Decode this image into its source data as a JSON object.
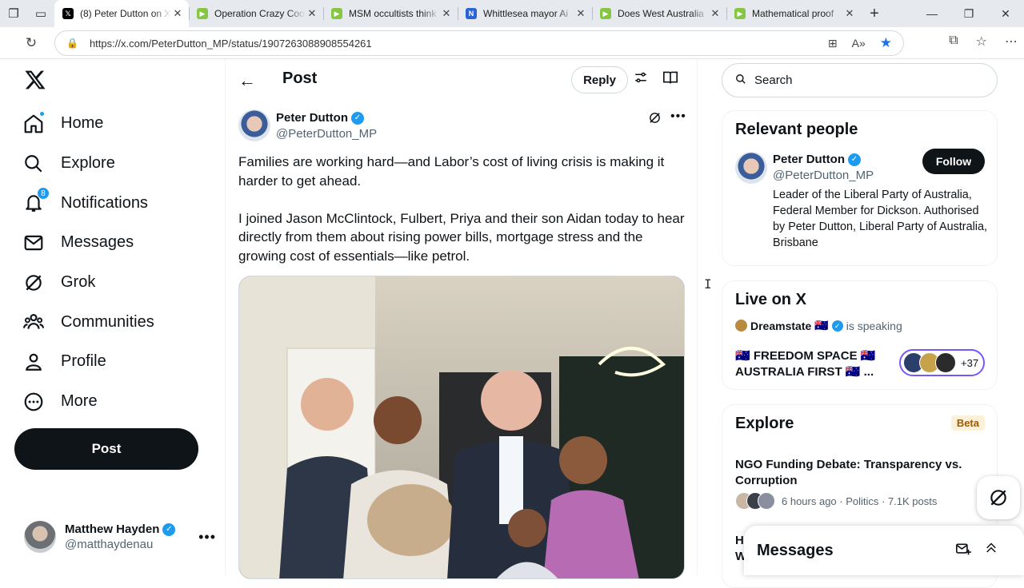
{
  "browser": {
    "tabs": [
      {
        "title": "(8) Peter Dutton on X",
        "active": true,
        "favicon": "x-logo",
        "color": "#000000"
      },
      {
        "title": "Operation Crazy Cooking",
        "active": false,
        "favicon": "rumble-icon",
        "color": "#85c742"
      },
      {
        "title": "MSM occultists think",
        "active": false,
        "favicon": "rumble-icon",
        "color": "#85c742"
      },
      {
        "title": "Whittlesea mayor Ai",
        "active": false,
        "favicon": "news-icon",
        "color": "#2a63d6"
      },
      {
        "title": "Does West Australia",
        "active": false,
        "favicon": "rumble-icon",
        "color": "#85c742"
      },
      {
        "title": "Mathematical proof",
        "active": false,
        "favicon": "rumble-icon",
        "color": "#85c742"
      }
    ],
    "url": "https://x.com/PeterDutton_MP/status/1907263088908554261"
  },
  "nav": {
    "items": [
      {
        "label": "Home",
        "icon": "home-icon"
      },
      {
        "label": "Explore",
        "icon": "search-icon"
      },
      {
        "label": "Notifications",
        "icon": "bell-icon",
        "badge": "8"
      },
      {
        "label": "Messages",
        "icon": "mail-icon"
      },
      {
        "label": "Grok",
        "icon": "grok-icon"
      },
      {
        "label": "Communities",
        "icon": "people-icon"
      },
      {
        "label": "Profile",
        "icon": "person-icon"
      },
      {
        "label": "More",
        "icon": "more-circle-icon"
      }
    ],
    "post_label": "Post"
  },
  "account": {
    "name": "Matthew Hayden",
    "handle": "@matthaydenau"
  },
  "main": {
    "title": "Post",
    "reply_label": "Reply",
    "author": {
      "name": "Peter Dutton",
      "handle": "@PeterDutton_MP"
    },
    "text_p1": "Families are working hard—and Labor’s cost of living crisis is making it harder to get ahead.",
    "text_p2": "I joined Jason McClintock, Fulbert, Priya and their son Aidan today to hear directly from them about rising power bills, mortgage stress and the growing cost of essentials—like petrol."
  },
  "sidebar": {
    "search_placeholder": "Search",
    "relevant": {
      "heading": "Relevant people",
      "name": "Peter Dutton",
      "handle": "@PeterDutton_MP",
      "follow_label": "Follow",
      "bio": "Leader of the Liberal Party of Australia, Federal Member for Dickson. Authorised by Peter Dutton, Liberal Party of Australia, Brisbane"
    },
    "live": {
      "heading": "Live on X",
      "host": "Dreamstate",
      "status": "is speaking",
      "title": "🇦🇺 FREEDOM SPACE 🇦🇺 AUSTRALIA FIRST 🇦🇺 ...",
      "listeners": "+37"
    },
    "explore": {
      "heading": "Explore",
      "beta": "Beta",
      "trend_title": "NGO Funding Debate: Transparency vs. Corruption",
      "trend_meta": "6 hours ago · Politics · 7.1K posts",
      "trend2_partial": "H\nW"
    },
    "messages_label": "Messages"
  },
  "colors": {
    "accent": "#1d9bf0",
    "text": "#0f1419",
    "muted": "#536471"
  }
}
